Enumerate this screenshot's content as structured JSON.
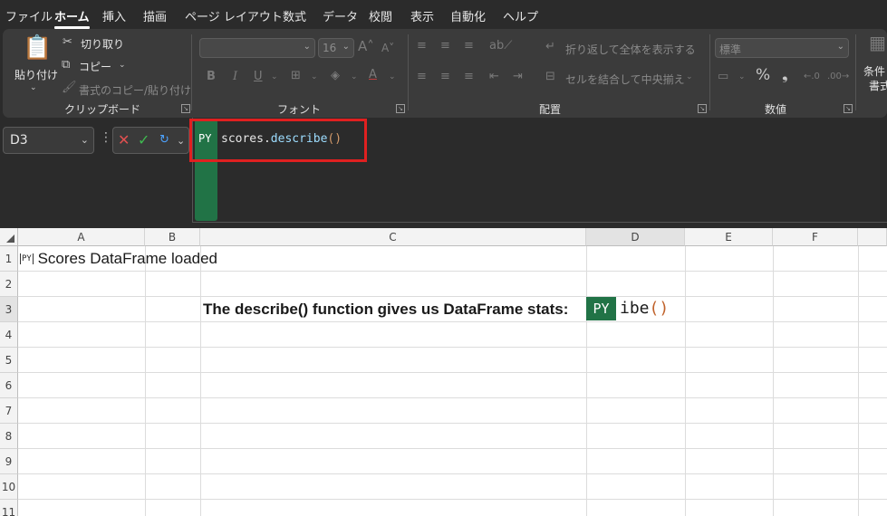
{
  "menu": {
    "tabs": [
      "ファイル",
      "ホーム",
      "挿入",
      "描画",
      "ページ レイアウト",
      "数式",
      "データ",
      "校閲",
      "表示",
      "自動化",
      "ヘルプ"
    ],
    "active_tab": "ホーム"
  },
  "ribbon": {
    "clipboard": {
      "paste_label": "貼り付け",
      "cut_label": "切り取り",
      "copy_label": "コピー",
      "format_painter_label": "書式のコピー/貼り付け",
      "group_label": "クリップボード"
    },
    "font": {
      "font_name_value": "",
      "font_size_value": "16",
      "bold": "B",
      "italic": "I",
      "underline": "U",
      "group_label": "フォント"
    },
    "alignment": {
      "wrap_text_label": "折り返して全体を表示する",
      "merge_center_label": "セルを結合して中央揃え",
      "group_label": "配置"
    },
    "number": {
      "format_value": "標準",
      "percent": "%",
      "comma": "❟",
      "group_label": "数値"
    },
    "styles": {
      "conditional_label_1": "条件",
      "conditional_label_2": "書式"
    }
  },
  "formula_bar": {
    "name_box": "D3",
    "py_badge": "PY",
    "formula_obj": "scores",
    "formula_dot": ".",
    "formula_fn": "describe",
    "formula_parens": "()"
  },
  "sheet": {
    "columns": [
      "A",
      "B",
      "C",
      "D",
      "E",
      "F"
    ],
    "rows": [
      "1",
      "2",
      "3",
      "4",
      "5",
      "6",
      "7",
      "8",
      "9",
      "10",
      "11"
    ],
    "a1_icon": "PY",
    "a1_text": "Scores DataFrame loaded",
    "c3_text": "The describe() function gives us DataFrame stats:",
    "d3_py_badge": "PY",
    "d3_text": "ibe",
    "d3_parens": "()"
  },
  "colors": {
    "python_green": "#217346",
    "highlight_red": "#e02020"
  }
}
